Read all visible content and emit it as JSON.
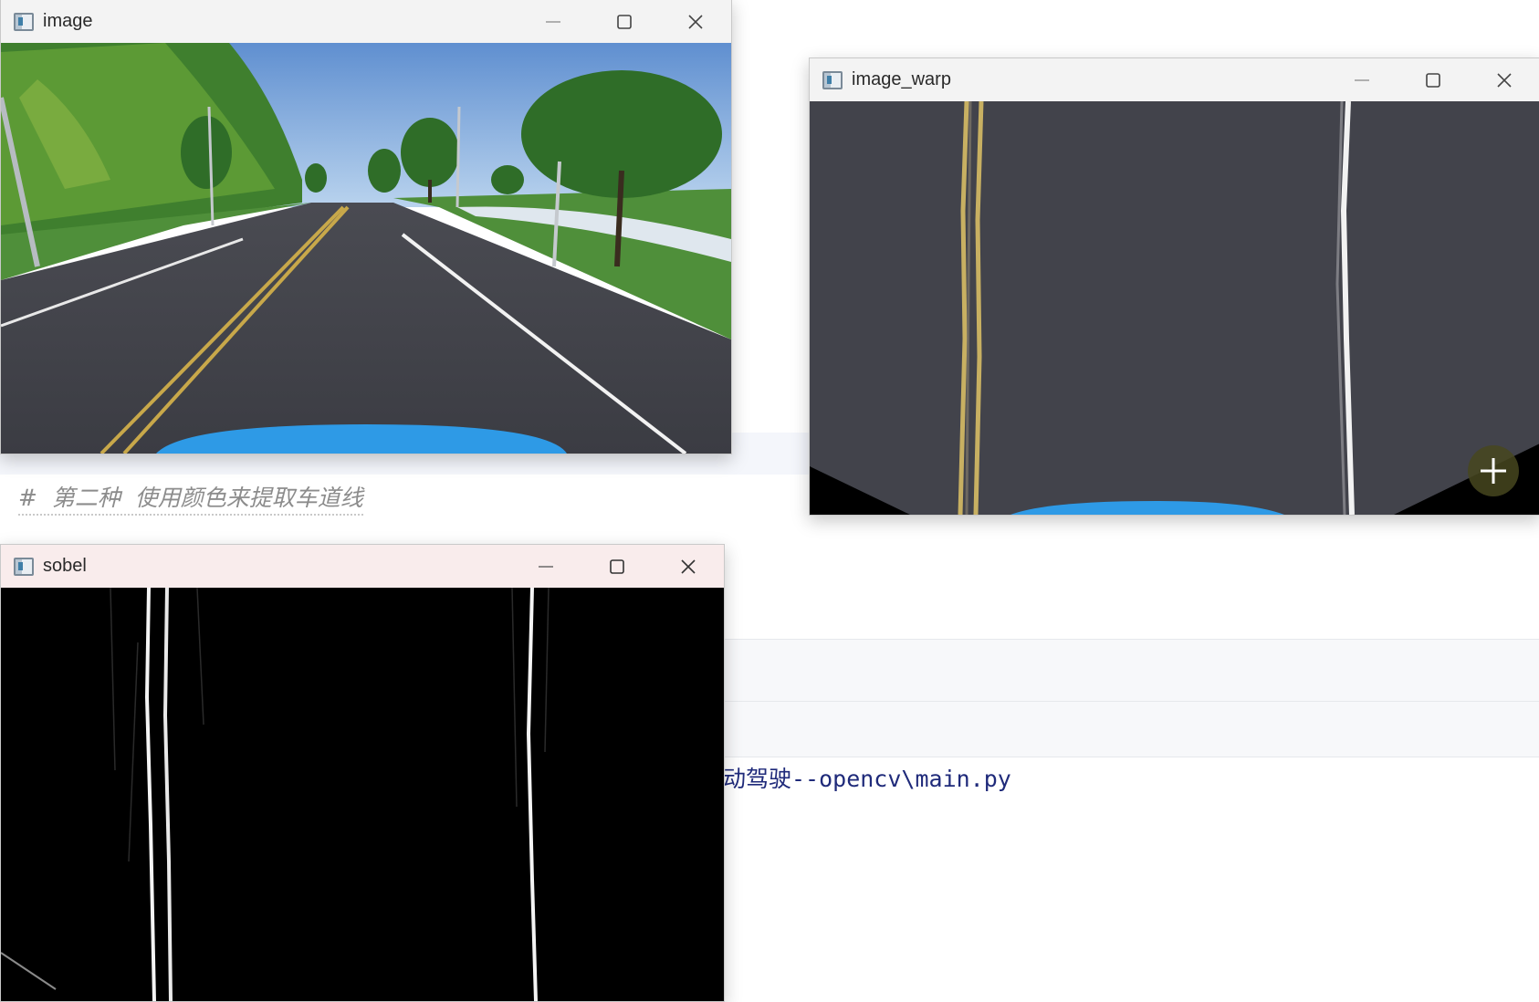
{
  "editor": {
    "comment_line": "#  第二种  使用颜色来提取车道线",
    "path_line": "动驾驶--opencv\\main.py"
  },
  "windows": {
    "image": {
      "title": "image"
    },
    "image_warp": {
      "title": "image_warp"
    },
    "sobel": {
      "title": "sobel"
    }
  },
  "icons": {
    "app": "opencv-window-icon",
    "minimize": "minimize-icon",
    "maximize": "maximize-icon",
    "close": "close-icon",
    "zoom": "plus-icon"
  }
}
